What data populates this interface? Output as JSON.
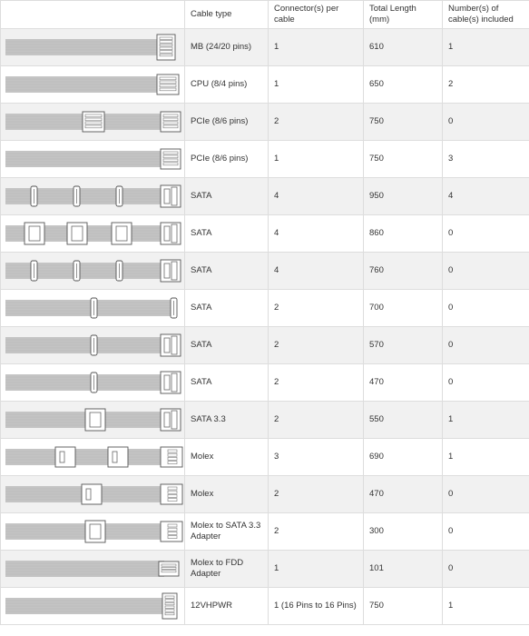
{
  "headers": [
    "",
    "Cable type",
    "Connector(s) per cable",
    "Total Length (mm)",
    "Number(s) of cable(s) included"
  ],
  "rows": [
    {
      "type": "MB (24/20 pins)",
      "connectors": "1",
      "length": "610",
      "count": "1",
      "icon": "mb-24pin-cable-icon"
    },
    {
      "type": "CPU (8/4 pins)",
      "connectors": "1",
      "length": "650",
      "count": "2",
      "icon": "cpu-8pin-cable-icon"
    },
    {
      "type": "PCIe (8/6 pins)",
      "connectors": "2",
      "length": "750",
      "count": "0",
      "icon": "pcie-dual-cable-icon"
    },
    {
      "type": "PCIe (8/6 pins)",
      "connectors": "1",
      "length": "750",
      "count": "3",
      "icon": "pcie-single-cable-icon"
    },
    {
      "type": "SATA",
      "connectors": "4",
      "length": "950",
      "count": "4",
      "icon": "sata-4-cable-icon"
    },
    {
      "type": "SATA",
      "connectors": "4",
      "length": "860",
      "count": "0",
      "icon": "sata-4-wide-cable-icon"
    },
    {
      "type": "SATA",
      "connectors": "4",
      "length": "760",
      "count": "0",
      "icon": "sata-4-cable-icon"
    },
    {
      "type": "SATA",
      "connectors": "2",
      "length": "700",
      "count": "0",
      "icon": "sata-2-slim-cable-icon"
    },
    {
      "type": "SATA",
      "connectors": "2",
      "length": "570",
      "count": "0",
      "icon": "sata-2-cable-icon"
    },
    {
      "type": "SATA",
      "connectors": "2",
      "length": "470",
      "count": "0",
      "icon": "sata-2-cable-icon"
    },
    {
      "type": "SATA 3.3",
      "connectors": "2",
      "length": "550",
      "count": "1",
      "icon": "sata33-cable-icon"
    },
    {
      "type": "Molex",
      "connectors": "3",
      "length": "690",
      "count": "1",
      "icon": "molex-3-cable-icon"
    },
    {
      "type": "Molex",
      "connectors": "2",
      "length": "470",
      "count": "0",
      "icon": "molex-2-cable-icon"
    },
    {
      "type": "Molex to SATA 3.3 Adapter",
      "connectors": "2",
      "length": "300",
      "count": "0",
      "icon": "molex-sata-adapter-icon"
    },
    {
      "type": "Molex to FDD Adapter",
      "connectors": "1",
      "length": "101",
      "count": "0",
      "icon": "molex-fdd-adapter-icon"
    },
    {
      "type": "12VHPWR",
      "connectors": "1 (16 Pins to 16 Pins)",
      "length": "750",
      "count": "1",
      "icon": "12vhpwr-cable-icon"
    }
  ]
}
